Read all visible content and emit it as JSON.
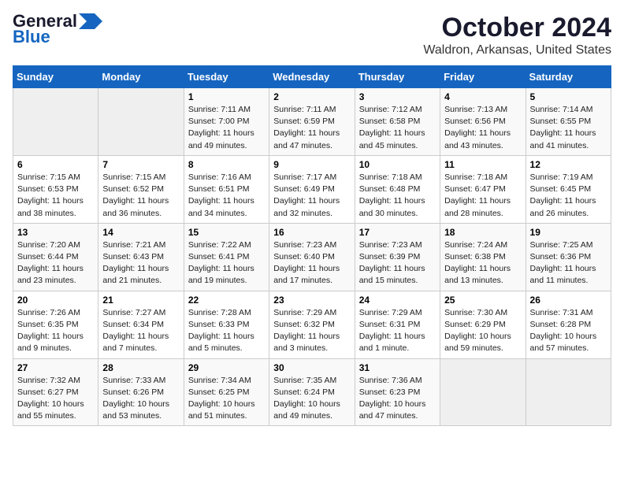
{
  "logo": {
    "line1": "General",
    "line2": "Blue"
  },
  "title": "October 2024",
  "subtitle": "Waldron, Arkansas, United States",
  "days_of_week": [
    "Sunday",
    "Monday",
    "Tuesday",
    "Wednesday",
    "Thursday",
    "Friday",
    "Saturday"
  ],
  "weeks": [
    [
      {
        "day": "",
        "empty": true
      },
      {
        "day": "",
        "empty": true
      },
      {
        "day": "1",
        "sunrise": "7:11 AM",
        "sunset": "7:00 PM",
        "daylight": "11 hours and 49 minutes."
      },
      {
        "day": "2",
        "sunrise": "7:11 AM",
        "sunset": "6:59 PM",
        "daylight": "11 hours and 47 minutes."
      },
      {
        "day": "3",
        "sunrise": "7:12 AM",
        "sunset": "6:58 PM",
        "daylight": "11 hours and 45 minutes."
      },
      {
        "day": "4",
        "sunrise": "7:13 AM",
        "sunset": "6:56 PM",
        "daylight": "11 hours and 43 minutes."
      },
      {
        "day": "5",
        "sunrise": "7:14 AM",
        "sunset": "6:55 PM",
        "daylight": "11 hours and 41 minutes."
      }
    ],
    [
      {
        "day": "6",
        "sunrise": "7:15 AM",
        "sunset": "6:53 PM",
        "daylight": "11 hours and 38 minutes."
      },
      {
        "day": "7",
        "sunrise": "7:15 AM",
        "sunset": "6:52 PM",
        "daylight": "11 hours and 36 minutes."
      },
      {
        "day": "8",
        "sunrise": "7:16 AM",
        "sunset": "6:51 PM",
        "daylight": "11 hours and 34 minutes."
      },
      {
        "day": "9",
        "sunrise": "7:17 AM",
        "sunset": "6:49 PM",
        "daylight": "11 hours and 32 minutes."
      },
      {
        "day": "10",
        "sunrise": "7:18 AM",
        "sunset": "6:48 PM",
        "daylight": "11 hours and 30 minutes."
      },
      {
        "day": "11",
        "sunrise": "7:18 AM",
        "sunset": "6:47 PM",
        "daylight": "11 hours and 28 minutes."
      },
      {
        "day": "12",
        "sunrise": "7:19 AM",
        "sunset": "6:45 PM",
        "daylight": "11 hours and 26 minutes."
      }
    ],
    [
      {
        "day": "13",
        "sunrise": "7:20 AM",
        "sunset": "6:44 PM",
        "daylight": "11 hours and 23 minutes."
      },
      {
        "day": "14",
        "sunrise": "7:21 AM",
        "sunset": "6:43 PM",
        "daylight": "11 hours and 21 minutes."
      },
      {
        "day": "15",
        "sunrise": "7:22 AM",
        "sunset": "6:41 PM",
        "daylight": "11 hours and 19 minutes."
      },
      {
        "day": "16",
        "sunrise": "7:23 AM",
        "sunset": "6:40 PM",
        "daylight": "11 hours and 17 minutes."
      },
      {
        "day": "17",
        "sunrise": "7:23 AM",
        "sunset": "6:39 PM",
        "daylight": "11 hours and 15 minutes."
      },
      {
        "day": "18",
        "sunrise": "7:24 AM",
        "sunset": "6:38 PM",
        "daylight": "11 hours and 13 minutes."
      },
      {
        "day": "19",
        "sunrise": "7:25 AM",
        "sunset": "6:36 PM",
        "daylight": "11 hours and 11 minutes."
      }
    ],
    [
      {
        "day": "20",
        "sunrise": "7:26 AM",
        "sunset": "6:35 PM",
        "daylight": "11 hours and 9 minutes."
      },
      {
        "day": "21",
        "sunrise": "7:27 AM",
        "sunset": "6:34 PM",
        "daylight": "11 hours and 7 minutes."
      },
      {
        "day": "22",
        "sunrise": "7:28 AM",
        "sunset": "6:33 PM",
        "daylight": "11 hours and 5 minutes."
      },
      {
        "day": "23",
        "sunrise": "7:29 AM",
        "sunset": "6:32 PM",
        "daylight": "11 hours and 3 minutes."
      },
      {
        "day": "24",
        "sunrise": "7:29 AM",
        "sunset": "6:31 PM",
        "daylight": "11 hours and 1 minute."
      },
      {
        "day": "25",
        "sunrise": "7:30 AM",
        "sunset": "6:29 PM",
        "daylight": "10 hours and 59 minutes."
      },
      {
        "day": "26",
        "sunrise": "7:31 AM",
        "sunset": "6:28 PM",
        "daylight": "10 hours and 57 minutes."
      }
    ],
    [
      {
        "day": "27",
        "sunrise": "7:32 AM",
        "sunset": "6:27 PM",
        "daylight": "10 hours and 55 minutes."
      },
      {
        "day": "28",
        "sunrise": "7:33 AM",
        "sunset": "6:26 PM",
        "daylight": "10 hours and 53 minutes."
      },
      {
        "day": "29",
        "sunrise": "7:34 AM",
        "sunset": "6:25 PM",
        "daylight": "10 hours and 51 minutes."
      },
      {
        "day": "30",
        "sunrise": "7:35 AM",
        "sunset": "6:24 PM",
        "daylight": "10 hours and 49 minutes."
      },
      {
        "day": "31",
        "sunrise": "7:36 AM",
        "sunset": "6:23 PM",
        "daylight": "10 hours and 47 minutes."
      },
      {
        "day": "",
        "empty": true
      },
      {
        "day": "",
        "empty": true
      }
    ]
  ]
}
